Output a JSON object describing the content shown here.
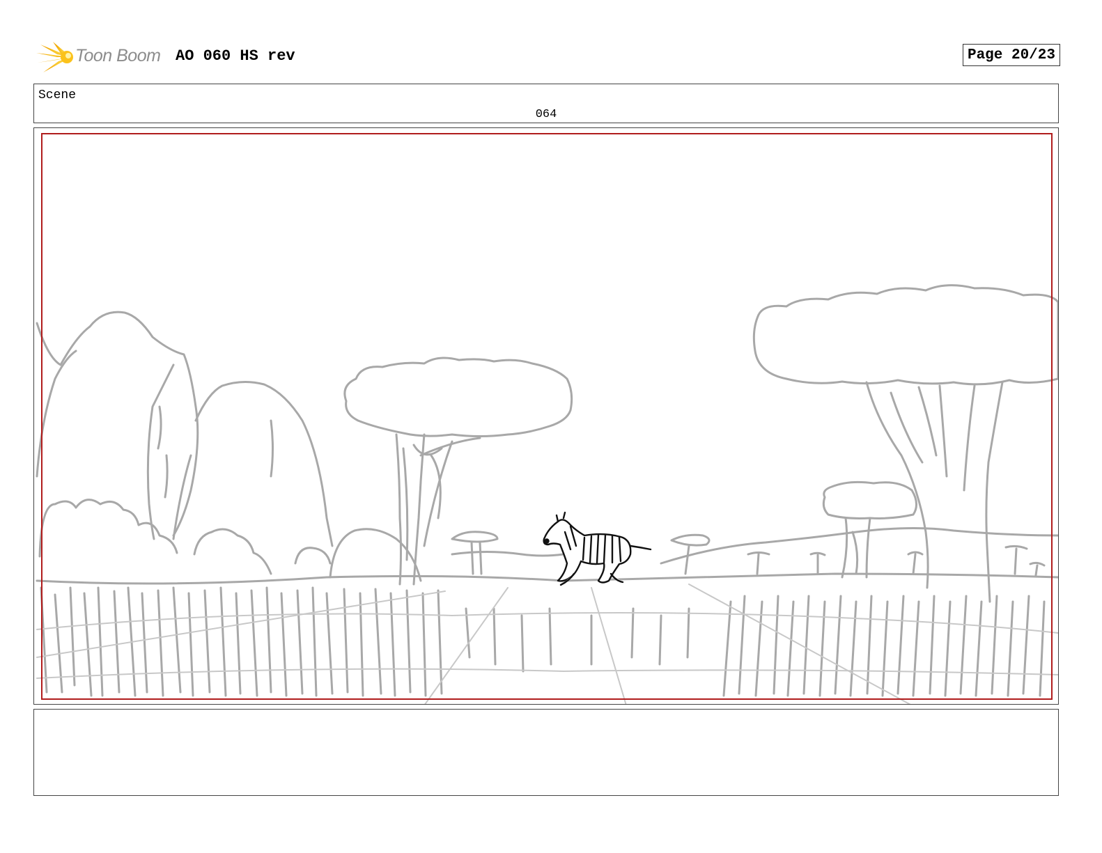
{
  "header": {
    "logo_text": "Toon Boom",
    "logo_icon": "sun-burst-logo",
    "title": "AO 060 HS rev",
    "page": "Page 20/23"
  },
  "scene": {
    "label": "Scene",
    "number": "064"
  },
  "panel": {
    "frame_color": "#b01c1c",
    "sketch_color": "#a8a8a8",
    "subject": "zebra-running"
  },
  "notes": {
    "text": ""
  }
}
